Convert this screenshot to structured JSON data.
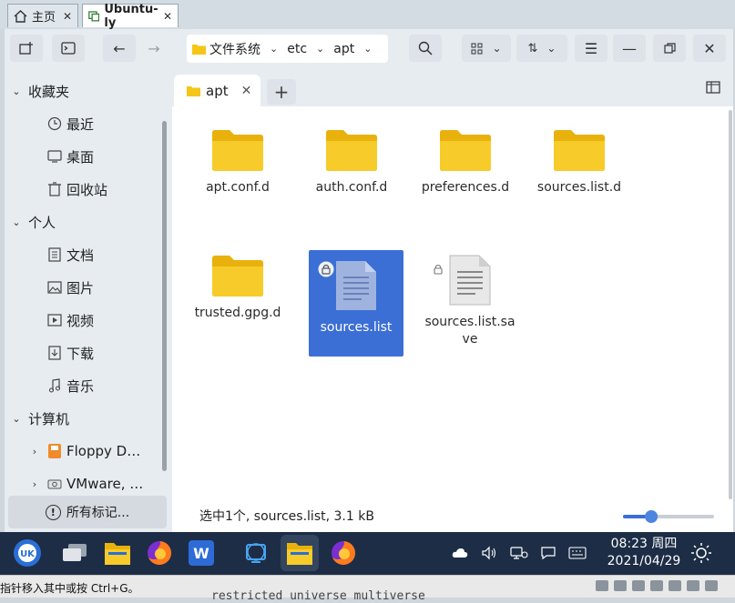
{
  "vm_tabs": [
    {
      "label": "主页",
      "icon": "home-icon"
    },
    {
      "label": "Ubuntu-ly",
      "icon": "vm-icon"
    }
  ],
  "path": [
    "文件系统",
    "etc",
    "apt"
  ],
  "sidebar": {
    "sections": [
      {
        "label": "收藏夹",
        "items": [
          {
            "label": "最近",
            "icon": "clock-icon"
          },
          {
            "label": "桌面",
            "icon": "desktop-icon"
          },
          {
            "label": "回收站",
            "icon": "trash-icon"
          }
        ]
      },
      {
        "label": "个人",
        "items": [
          {
            "label": "文档",
            "icon": "document-icon"
          },
          {
            "label": "图片",
            "icon": "picture-icon"
          },
          {
            "label": "视频",
            "icon": "video-icon"
          },
          {
            "label": "下载",
            "icon": "download-icon"
          },
          {
            "label": "音乐",
            "icon": "music-icon"
          }
        ]
      },
      {
        "label": "计算机",
        "items": [
          {
            "label": "Floppy D…",
            "icon": "floppy-icon"
          },
          {
            "label": "VMware, …",
            "icon": "drive-icon"
          }
        ]
      }
    ],
    "tag_button": "所有标记..."
  },
  "tab": {
    "label": "apt"
  },
  "files": [
    {
      "name": "apt.conf.d",
      "type": "folder"
    },
    {
      "name": "auth.conf.d",
      "type": "folder"
    },
    {
      "name": "preferences.d",
      "type": "folder"
    },
    {
      "name": "sources.list.d",
      "type": "folder"
    },
    {
      "name": "trusted.gpg.d",
      "type": "folder"
    },
    {
      "name": "sources.list",
      "type": "file",
      "selected": true,
      "locked": true
    },
    {
      "name": "sources.list.save",
      "type": "file",
      "locked": true
    }
  ],
  "status_text": "选中1个, sources.list, 3.1 kB",
  "zoom_level": 0.28,
  "taskbar": {
    "apps": [
      "start-menu",
      "multitask-view",
      "file-manager",
      "firefox",
      "wps-writer",
      "system-monitor",
      "file-manager-active",
      "firefox-active"
    ],
    "time": "08:23 周四",
    "date": "2021/04/29"
  },
  "vm_status": {
    "hint": "指针移入其中或按 Ctrl+G。",
    "behind_text": "restricted universe multiverse"
  },
  "colors": {
    "folder": "#f5c518",
    "selection": "#3c6fd6",
    "taskbar": "#1c2d45"
  }
}
